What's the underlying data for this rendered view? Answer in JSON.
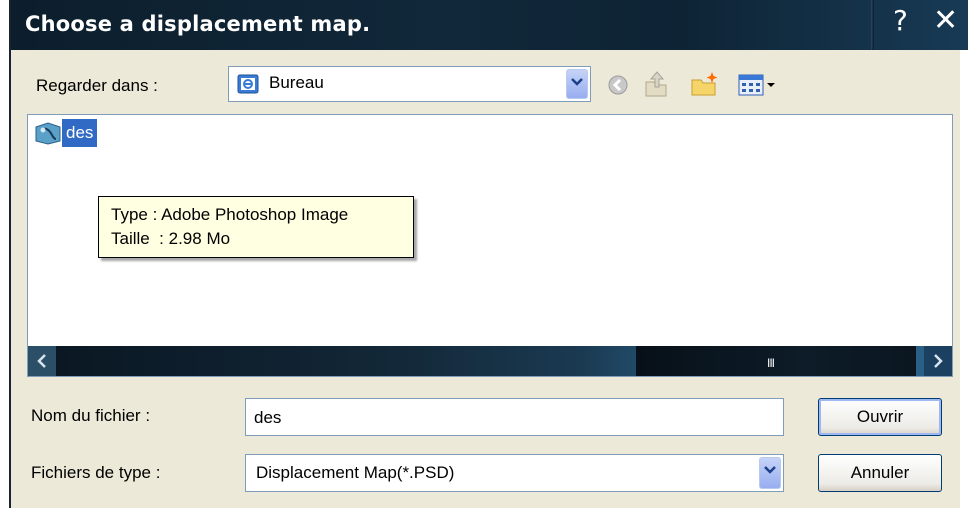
{
  "window": {
    "title": "Choose a displacement map.",
    "help_label": "?",
    "close_label": "✕"
  },
  "look_in": {
    "label": "Regarder dans :",
    "value": "Bureau",
    "icon": "desktop-icon"
  },
  "toolbar": {
    "icons": [
      "back-icon",
      "up-folder-icon",
      "new-folder-icon",
      "view-menu-icon"
    ]
  },
  "files": [
    {
      "name": "des",
      "icon": "photoshop-file-icon",
      "selected": true
    }
  ],
  "tooltip": {
    "type_line": "Type : Adobe Photoshop Image",
    "size_line": "Taille  : 2.98 Mo"
  },
  "scrollbar": {
    "grip": "III"
  },
  "filename": {
    "label": "Nom du fichier :",
    "value": "des"
  },
  "filetype": {
    "label": "Fichiers de type :",
    "value": "Displacement Map(*.PSD)"
  },
  "buttons": {
    "open": "Ouvrir",
    "cancel": "Annuler"
  },
  "colors": {
    "titlebar": "#0c1e2c",
    "selection": "#316ac5",
    "tooltip_bg": "#ffffe1",
    "dialog_bg": "#ece9d8"
  }
}
